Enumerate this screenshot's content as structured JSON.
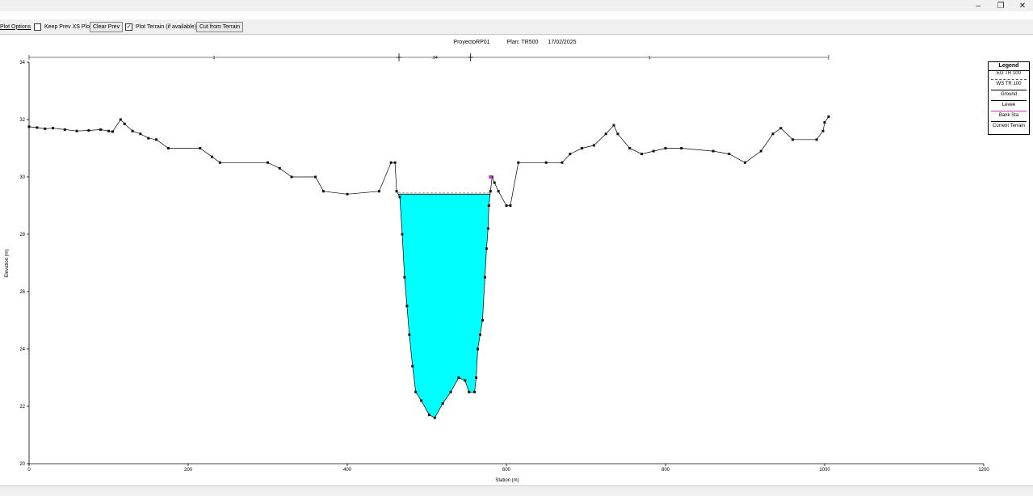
{
  "window": {
    "minimize_icon": "–",
    "maximize_icon": "❐",
    "close_icon": "✕"
  },
  "toolbar": {
    "plot_options": "Plot Options",
    "keep_prev_xs": "Keep Prev XS Plots",
    "keep_prev_xs_checked": false,
    "clear_prev": "Clear Prev",
    "plot_terrain": "Plot Terrain (if available)",
    "plot_terrain_checked": true,
    "cut_from_terrain": "Cut from Terrain"
  },
  "plot_header": {
    "project": "ProyectoRP01",
    "plan": "Plan: TR500",
    "date": "17/02/2025"
  },
  "legend": {
    "title": "Legend",
    "items": [
      "EG TR 100",
      "WS TR 100",
      "Ground",
      "Levee",
      "Bank Sta",
      "Current Terrain"
    ]
  },
  "chart_data": {
    "type": "line",
    "xlabel": "Station (m)",
    "ylabel": "Elevation (m)",
    "xlim": [
      0,
      1200
    ],
    "ylim": [
      20,
      34
    ],
    "xticks": [
      0,
      200,
      400,
      600,
      800,
      1000,
      1200
    ],
    "yticks": [
      20,
      22,
      24,
      26,
      28,
      30,
      32,
      34
    ],
    "manning": [
      {
        "from": 0,
        "to": 465,
        "label": "1"
      },
      {
        "from": 465,
        "to": 555,
        "label": ".04"
      },
      {
        "from": 555,
        "to": 1005,
        "label": "1"
      }
    ],
    "water_surface": 29.4,
    "bank_stations": [
      465,
      555
    ],
    "levee": [
      580,
      30.0
    ],
    "ground": [
      [
        0,
        31.75
      ],
      [
        10,
        31.72
      ],
      [
        20,
        31.68
      ],
      [
        30,
        31.7
      ],
      [
        45,
        31.65
      ],
      [
        60,
        31.6
      ],
      [
        75,
        31.62
      ],
      [
        90,
        31.65
      ],
      [
        100,
        31.6
      ],
      [
        105,
        31.58
      ],
      [
        115,
        32.0
      ],
      [
        120,
        31.85
      ],
      [
        130,
        31.6
      ],
      [
        140,
        31.5
      ],
      [
        150,
        31.35
      ],
      [
        160,
        31.3
      ],
      [
        175,
        31.0
      ],
      [
        215,
        31.0
      ],
      [
        230,
        30.7
      ],
      [
        240,
        30.5
      ],
      [
        300,
        30.5
      ],
      [
        315,
        30.3
      ],
      [
        330,
        30.0
      ],
      [
        360,
        30.0
      ],
      [
        370,
        29.5
      ],
      [
        400,
        29.4
      ],
      [
        440,
        29.5
      ],
      [
        455,
        30.5
      ],
      [
        460,
        30.5
      ],
      [
        462,
        29.5
      ],
      [
        466,
        29.3
      ],
      [
        469,
        28.0
      ],
      [
        472,
        26.5
      ],
      [
        475,
        25.5
      ],
      [
        478,
        24.5
      ],
      [
        482,
        23.4
      ],
      [
        486,
        22.5
      ],
      [
        493,
        22.2
      ],
      [
        503,
        21.7
      ],
      [
        510,
        21.6
      ],
      [
        520,
        22.1
      ],
      [
        530,
        22.5
      ],
      [
        540,
        23.0
      ],
      [
        548,
        22.9
      ],
      [
        553,
        22.5
      ],
      [
        560,
        22.5
      ],
      [
        562,
        23.0
      ],
      [
        564,
        24.0
      ],
      [
        567,
        24.5
      ],
      [
        570,
        25.0
      ],
      [
        573,
        26.5
      ],
      [
        575,
        27.5
      ],
      [
        577,
        28.2
      ],
      [
        578,
        29.0
      ],
      [
        580,
        29.5
      ],
      [
        582,
        30.0
      ],
      [
        585,
        29.8
      ],
      [
        590,
        29.5
      ],
      [
        600,
        29.0
      ],
      [
        605,
        29.0
      ],
      [
        615,
        30.5
      ],
      [
        650,
        30.5
      ],
      [
        670,
        30.5
      ],
      [
        680,
        30.8
      ],
      [
        695,
        31.0
      ],
      [
        710,
        31.1
      ],
      [
        725,
        31.5
      ],
      [
        735,
        31.8
      ],
      [
        740,
        31.5
      ],
      [
        755,
        31.0
      ],
      [
        770,
        30.8
      ],
      [
        785,
        30.9
      ],
      [
        800,
        31.0
      ],
      [
        820,
        31.0
      ],
      [
        860,
        30.9
      ],
      [
        880,
        30.8
      ],
      [
        900,
        30.5
      ],
      [
        920,
        30.9
      ],
      [
        935,
        31.5
      ],
      [
        945,
        31.7
      ],
      [
        960,
        31.3
      ],
      [
        990,
        31.3
      ],
      [
        998,
        31.6
      ],
      [
        1000,
        31.9
      ],
      [
        1005,
        32.1
      ]
    ]
  }
}
